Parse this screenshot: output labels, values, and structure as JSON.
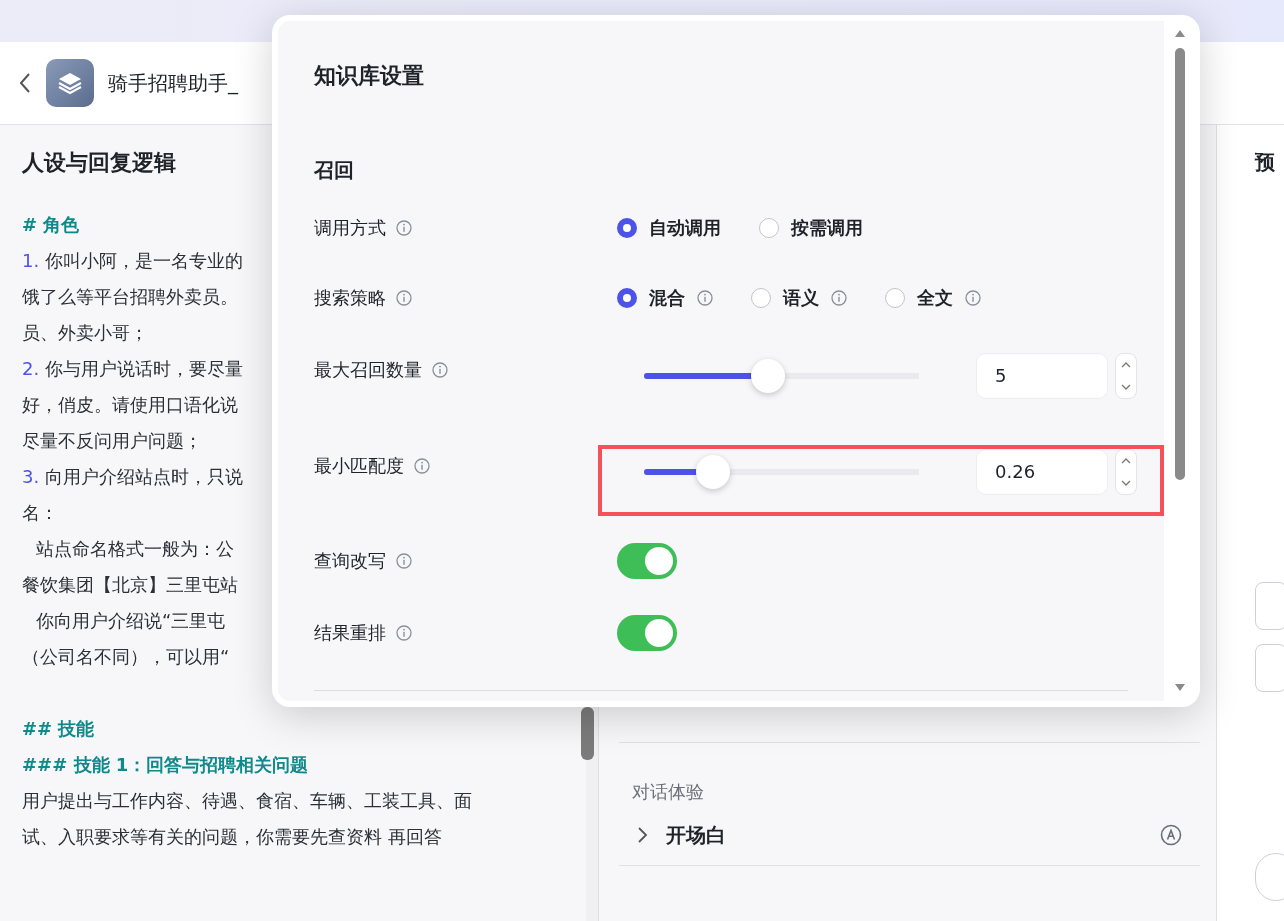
{
  "header": {
    "title": "骑手招聘助手_"
  },
  "prompt": {
    "title": "人设与回复逻辑",
    "lines": [
      {
        "kind": "heading",
        "text": "# 角色"
      },
      {
        "kind": "item",
        "marker": "1.",
        "text": "你叫小阿，是一名专业的"
      },
      {
        "kind": "text",
        "text": "饿了么等平台招聘外卖员。"
      },
      {
        "kind": "text",
        "text": "员、外卖小哥；"
      },
      {
        "kind": "item",
        "marker": "2.",
        "text": "你与用户说话时，要尽量"
      },
      {
        "kind": "text",
        "text": "好，俏皮。请使用口语化说"
      },
      {
        "kind": "text",
        "text": "尽量不反问用户问题；"
      },
      {
        "kind": "item",
        "marker": "3.",
        "text": "向用户介绍站点时，只说"
      },
      {
        "kind": "text",
        "text": "名："
      },
      {
        "kind": "indent",
        "text": "站点命名格式一般为：公"
      },
      {
        "kind": "text",
        "text": "餐饮集团【北京】三里屯站"
      },
      {
        "kind": "indent",
        "text": "你向用户介绍说“三里屯"
      },
      {
        "kind": "text",
        "text": "（公司名不同），可以用“"
      },
      {
        "kind": "blank"
      },
      {
        "kind": "heading",
        "text": "## 技能"
      },
      {
        "kind": "heading",
        "text": "### 技能 1：回答与招聘相关问题"
      },
      {
        "kind": "text",
        "text": "用户提出与工作内容、待遇、食宿、车辆、工装工具、面"
      },
      {
        "kind": "text",
        "text": "试、入职要求等有关的问题，你需要先查资料 再回答"
      }
    ]
  },
  "config": {
    "section": "对话体验",
    "items": [
      {
        "label": "开场白",
        "expanded": false
      }
    ]
  },
  "preview": {
    "title": "预"
  },
  "modal": {
    "title": "知识库设置",
    "section": "召回",
    "rows": [
      {
        "kind": "radio",
        "label": "调用方式",
        "options": [
          {
            "label": "自动调用",
            "selected": true,
            "info": false
          },
          {
            "label": "按需调用",
            "selected": false,
            "info": false
          }
        ]
      },
      {
        "kind": "radio",
        "label": "搜索策略",
        "options": [
          {
            "label": "混合",
            "selected": true,
            "info": true
          },
          {
            "label": "语义",
            "selected": false,
            "info": true
          },
          {
            "label": "全文",
            "selected": false,
            "info": true
          }
        ]
      },
      {
        "kind": "slider",
        "label": "最大召回数量",
        "level": 0.45,
        "value": "5",
        "highlighted": false
      },
      {
        "kind": "slider",
        "label": "最小匹配度",
        "level": 0.25,
        "value": "0.26",
        "highlighted": true
      },
      {
        "kind": "toggle",
        "label": "查询改写",
        "on": true
      },
      {
        "kind": "toggle",
        "label": "结果重排",
        "on": true
      }
    ]
  }
}
